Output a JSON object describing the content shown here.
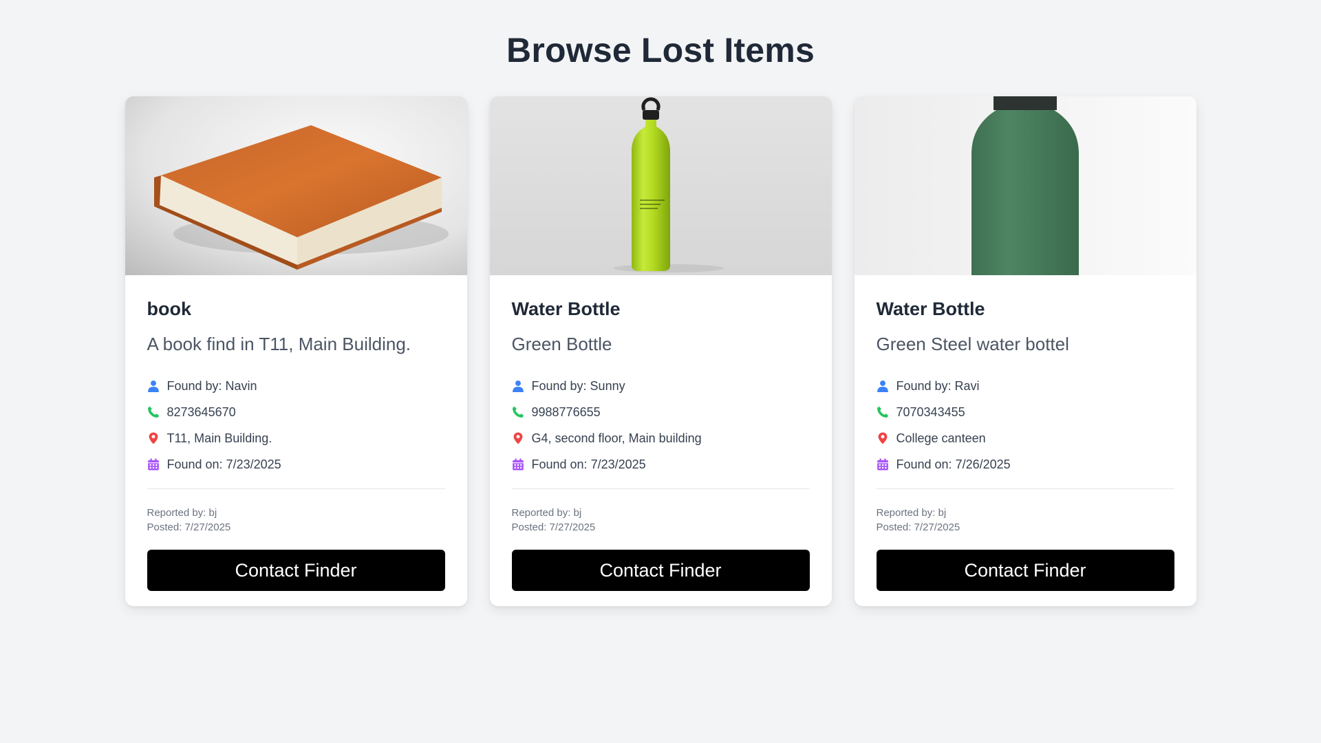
{
  "page": {
    "title": "Browse Lost Items"
  },
  "colors": {
    "user_icon": "#3b82f6",
    "phone_icon": "#22c55e",
    "location_icon": "#ef4444",
    "calendar_icon": "#a855f7",
    "button_bg": "#000000"
  },
  "items": [
    {
      "title": "book",
      "description": "A book find in T11, Main Building.",
      "found_by": "Found by: Navin",
      "phone": "8273645670",
      "location": "T11, Main Building.",
      "found_on": "Found on: 7/23/2025",
      "reported_by": "Reported by: bj",
      "posted": "Posted: 7/27/2025",
      "button_label": "Contact Finder",
      "image": "book-photo"
    },
    {
      "title": "Water Bottle",
      "description": "Green Bottle",
      "found_by": "Found by: Sunny",
      "phone": "9988776655",
      "location": "G4, second floor, Main building",
      "found_on": "Found on: 7/23/2025",
      "reported_by": "Reported by: bj",
      "posted": "Posted: 7/27/2025",
      "button_label": "Contact Finder",
      "image": "lime-sport-bottle-photo"
    },
    {
      "title": "Water Bottle",
      "description": "Green Steel water bottel",
      "found_by": "Found by: Ravi",
      "phone": "7070343455",
      "location": "College canteen",
      "found_on": "Found on: 7/26/2025",
      "reported_by": "Reported by: bj",
      "posted": "Posted: 7/27/2025",
      "button_label": "Contact Finder",
      "image": "green-steel-bottle-photo"
    }
  ]
}
